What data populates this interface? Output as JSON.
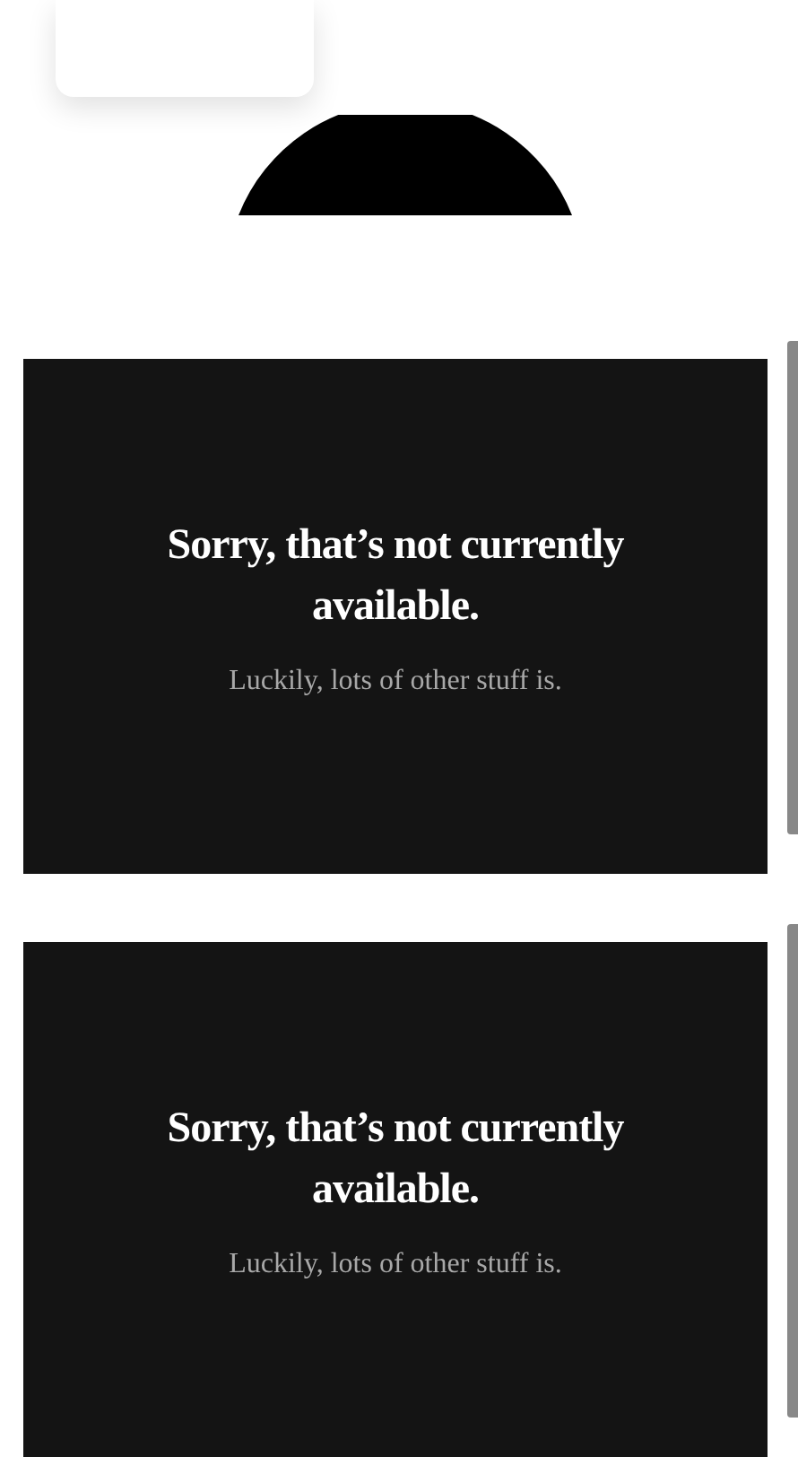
{
  "panels": [
    {
      "title": "Sorry, that’s not currently available.",
      "message": "Luckily, lots of other stuff is."
    },
    {
      "title": "Sorry, that’s not currently available.",
      "message": "Luckily, lots of other stuff is."
    }
  ]
}
